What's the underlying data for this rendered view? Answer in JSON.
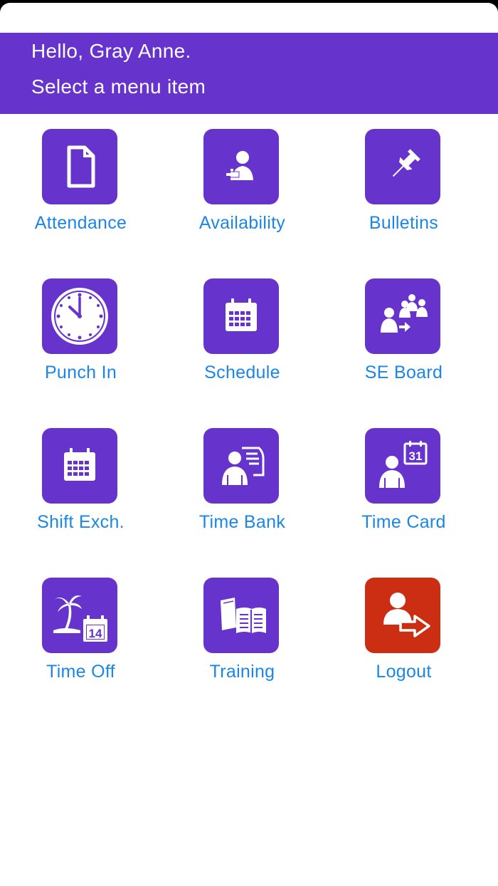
{
  "header": {
    "greeting": "Hello, Gray Anne.",
    "subtitle": "Select a menu item"
  },
  "colors": {
    "accent": "#6633cc",
    "logout": "#cc2e14",
    "label": "#1a86e8"
  },
  "menu": {
    "items": [
      {
        "label": "Attendance",
        "icon": "document-icon"
      },
      {
        "label": "Availability",
        "icon": "person-plus-icon"
      },
      {
        "label": "Bulletins",
        "icon": "pushpin-icon"
      },
      {
        "label": "Punch In",
        "icon": "clock-icon"
      },
      {
        "label": "Schedule",
        "icon": "calendar-icon"
      },
      {
        "label": "SE Board",
        "icon": "group-arrow-icon"
      },
      {
        "label": "Shift Exch.",
        "icon": "calendar-icon"
      },
      {
        "label": "Time Bank",
        "icon": "person-card-icon"
      },
      {
        "label": "Time Card",
        "icon": "person-calendar-icon",
        "calendar_day": "31"
      },
      {
        "label": "Time Off",
        "icon": "palm-calendar-icon",
        "calendar_day": "14"
      },
      {
        "label": "Training",
        "icon": "books-icon"
      },
      {
        "label": "Logout",
        "icon": "person-exit-icon"
      }
    ]
  }
}
